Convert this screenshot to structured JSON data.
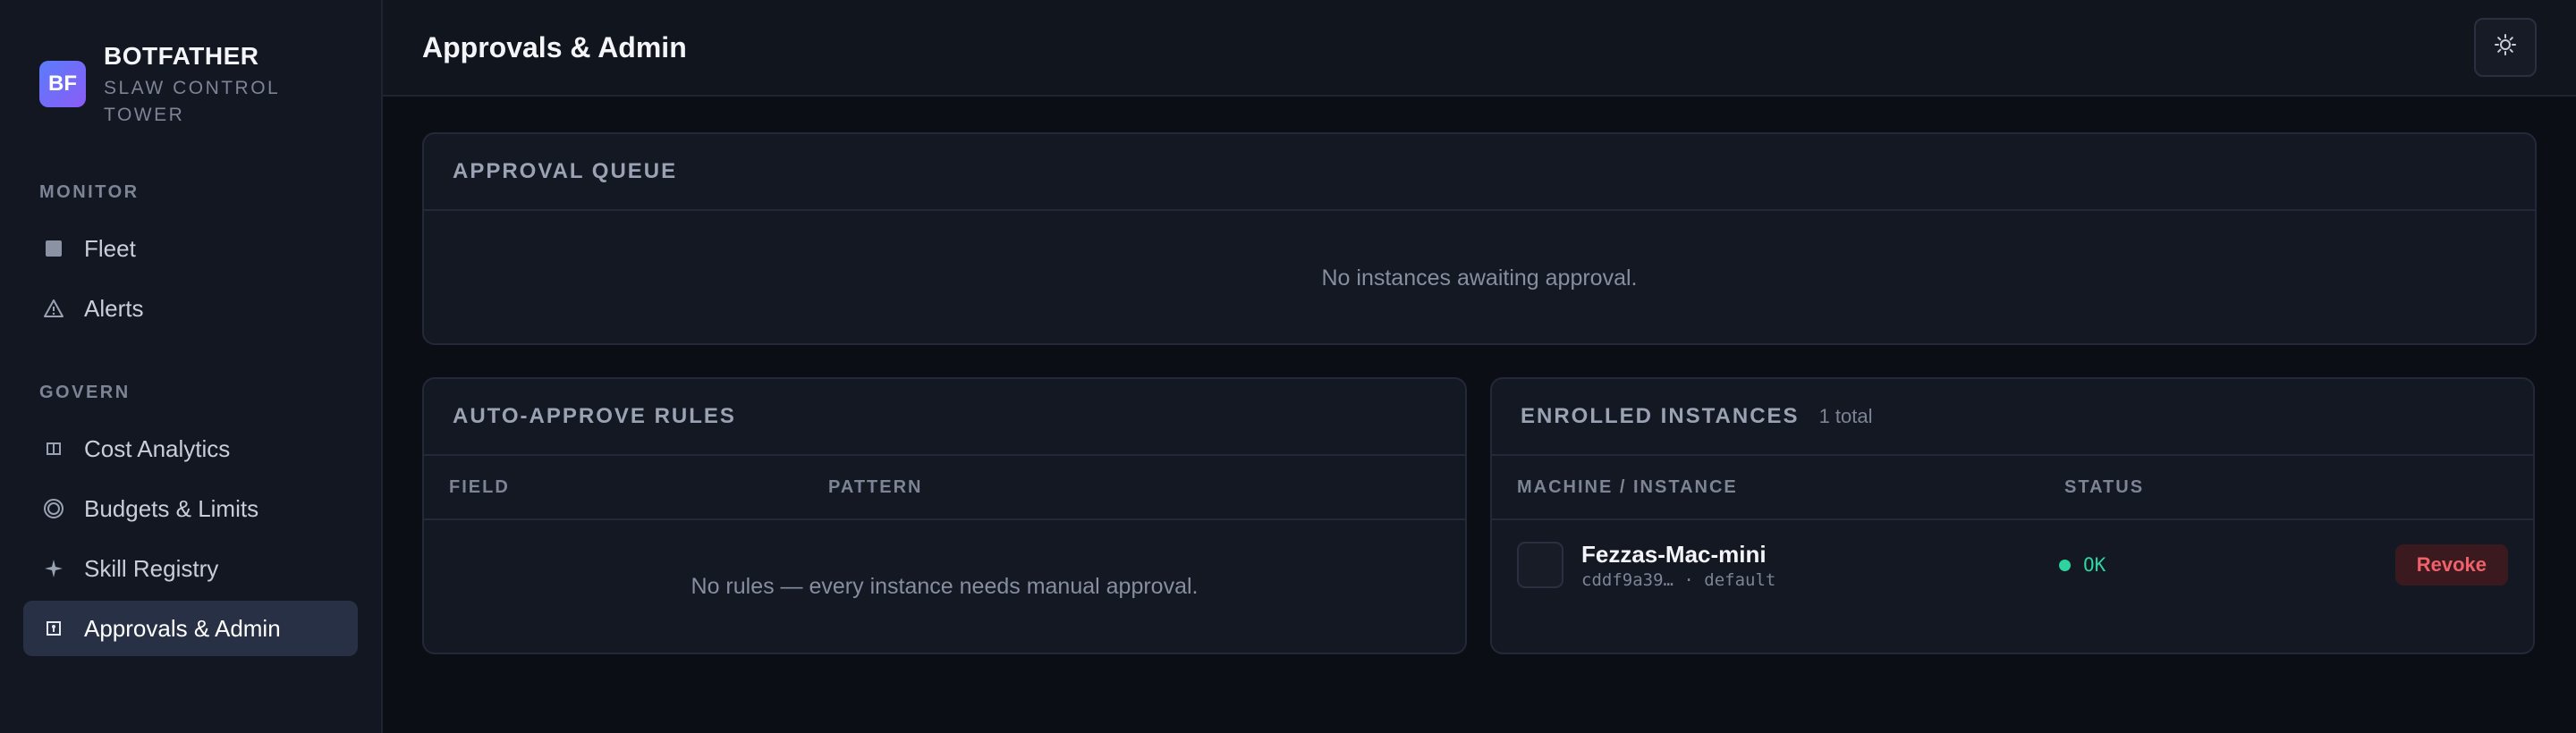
{
  "brand": {
    "logo_text": "BF",
    "name": "BOTFATHER",
    "subtitle": "SLAW CONTROL TOWER"
  },
  "sidebar": {
    "sections": [
      {
        "label": "MONITOR",
        "items": [
          {
            "label": "Fleet",
            "icon": "square-icon"
          },
          {
            "label": "Alerts",
            "icon": "warning-icon"
          }
        ]
      },
      {
        "label": "GOVERN",
        "items": [
          {
            "label": "Cost Analytics",
            "icon": "columns-icon"
          },
          {
            "label": "Budgets & Limits",
            "icon": "target-icon"
          },
          {
            "label": "Skill Registry",
            "icon": "sparkle-icon"
          },
          {
            "label": "Approvals & Admin",
            "icon": "key-icon",
            "active": true
          }
        ]
      }
    ]
  },
  "header": {
    "title": "Approvals & Admin",
    "theme_icon": "sun-icon"
  },
  "approval_queue": {
    "title": "APPROVAL QUEUE",
    "empty": "No instances awaiting approval."
  },
  "auto_approve": {
    "title": "AUTO-APPROVE RULES",
    "columns": [
      "FIELD",
      "PATTERN"
    ],
    "empty": "No rules — every instance needs manual approval."
  },
  "enrolled": {
    "title": "ENROLLED INSTANCES",
    "count": "1 total",
    "columns": [
      "MACHINE / INSTANCE",
      "STATUS"
    ],
    "rows": [
      {
        "name": "Fezzas-Mac-mini",
        "sub": "cddf9a39… · default",
        "status": "OK",
        "action": "Revoke"
      }
    ]
  },
  "colors": {
    "accent": "#5b7cfa",
    "ok": "#2dd4a0",
    "danger": "#f0616a"
  }
}
